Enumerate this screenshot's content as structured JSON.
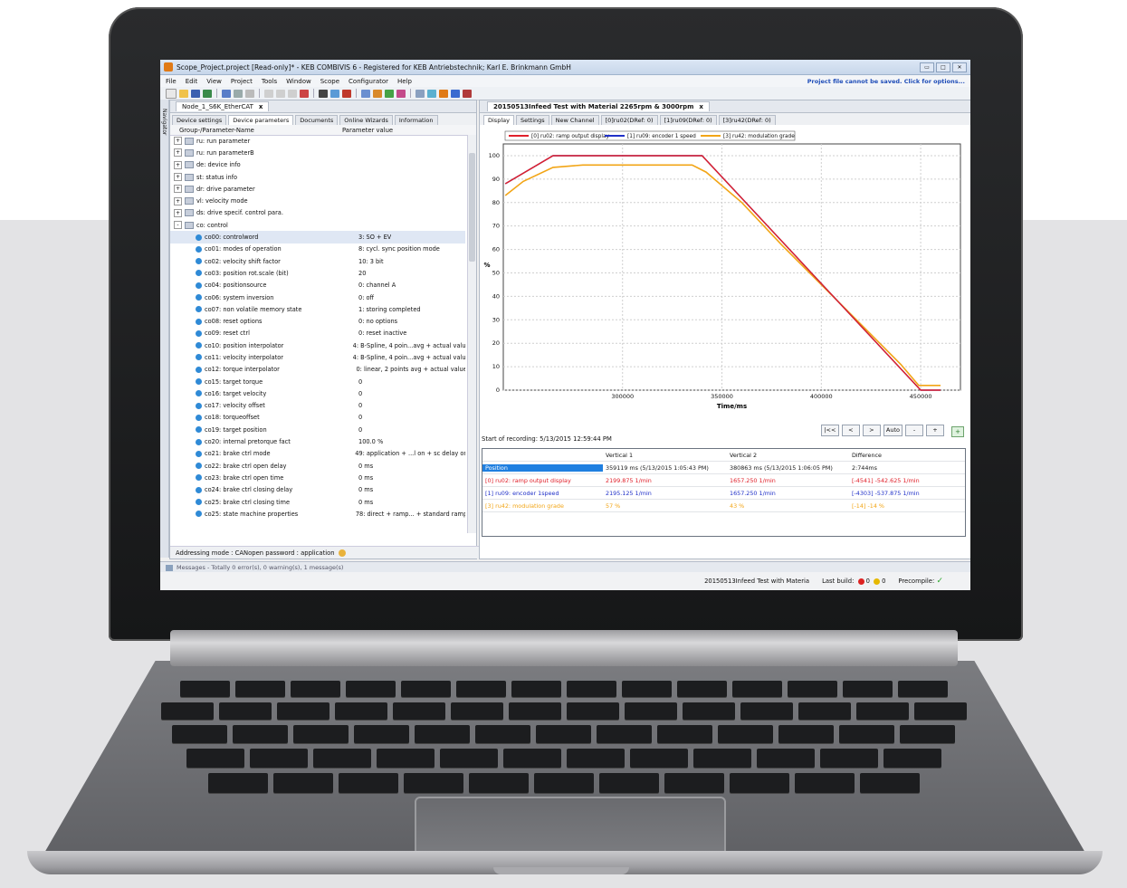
{
  "window": {
    "title": "Scope_Project.project [Read-only]* - KEB COMBIVIS 6  - Registered for KEB Antriebstechnik; Karl E. Brinkmann GmbH",
    "buttons": [
      "▭",
      "□",
      "✕"
    ]
  },
  "menu": {
    "items": [
      "File",
      "Edit",
      "View",
      "Project",
      "Tools",
      "Window",
      "Scope",
      "Configurator",
      "Help"
    ],
    "warning": "Project file cannot be saved. Click for options..."
  },
  "navigator": {
    "label": "Navigator"
  },
  "left_pane": {
    "doc_tab": "Node_1_S6K_EtherCAT",
    "close": "x",
    "sub_tabs": [
      "Device settings",
      "Device parameters",
      "Documents",
      "Online Wizards",
      "Information"
    ],
    "active_sub_tab": 1,
    "columns": [
      "Group-/Parameter-Name",
      "Parameter value"
    ],
    "rows": [
      {
        "name": "ru: run parameter",
        "value": "",
        "type": "group",
        "exp": "+"
      },
      {
        "name": "ru: run parameterB",
        "value": "",
        "type": "group",
        "exp": "+"
      },
      {
        "name": "de: device info",
        "value": "",
        "type": "group",
        "exp": "+"
      },
      {
        "name": "st: status info",
        "value": "",
        "type": "group",
        "exp": "+"
      },
      {
        "name": "dr: drive parameter",
        "value": "",
        "type": "group",
        "exp": "+"
      },
      {
        "name": "vl: velocity mode",
        "value": "",
        "type": "group",
        "exp": "+"
      },
      {
        "name": "ds: drive specif. control para.",
        "value": "",
        "type": "group",
        "exp": "+"
      },
      {
        "name": "co: control",
        "value": "",
        "type": "group",
        "exp": "-"
      },
      {
        "name": "co00: controlword",
        "value": "3: SO + EV",
        "type": "leaf",
        "selected": true
      },
      {
        "name": "co01: modes of operation",
        "value": "8: cycl. sync position mode",
        "type": "leaf"
      },
      {
        "name": "co02: velocity shift factor",
        "value": "10: 3 bit",
        "type": "leaf"
      },
      {
        "name": "co03: position rot.scale (bit)",
        "value": "20",
        "type": "leaf"
      },
      {
        "name": "co04: positionsource",
        "value": "0: channel A",
        "type": "leaf"
      },
      {
        "name": "co06: system inversion",
        "value": "0: off",
        "type": "leaf"
      },
      {
        "name": "co07: non volatile memory state",
        "value": "1: storing completed",
        "type": "leaf"
      },
      {
        "name": "co08: reset options",
        "value": "0: no options",
        "type": "leaf"
      },
      {
        "name": "co09: reset ctrl",
        "value": "0: reset inactive",
        "type": "leaf"
      },
      {
        "name": "co10: position interpolator",
        "value": "4: B-Spline, 4 poin...avg + actual value",
        "type": "leaf"
      },
      {
        "name": "co11: velocity interpolator",
        "value": "4: B-Spline, 4 poin...avg + actual value",
        "type": "leaf"
      },
      {
        "name": "co12: torque interpolator",
        "value": "0: linear, 2 points avg + actual value",
        "type": "leaf"
      },
      {
        "name": "co15: target torque",
        "value": "0",
        "type": "leaf"
      },
      {
        "name": "co16: target velocity",
        "value": "0",
        "type": "leaf"
      },
      {
        "name": "co17: velocity offset",
        "value": "0",
        "type": "leaf"
      },
      {
        "name": "co18: torqueoffset",
        "value": "0",
        "type": "leaf"
      },
      {
        "name": "co19: target position",
        "value": "0",
        "type": "leaf"
      },
      {
        "name": "co20: internal pretorque fact",
        "value": "100.0 %",
        "type": "leaf"
      },
      {
        "name": "co21: brake ctrl mode",
        "value": "49: application + ...l on + sc delay on",
        "type": "leaf"
      },
      {
        "name": "co22: brake ctrl open delay",
        "value": "0 ms",
        "type": "leaf"
      },
      {
        "name": "co23: brake ctrl open time",
        "value": "0 ms",
        "type": "leaf"
      },
      {
        "name": "co24: brake ctrl closing delay",
        "value": "0 ms",
        "type": "leaf"
      },
      {
        "name": "co25: brake ctrl closing time",
        "value": "0 ms",
        "type": "leaf"
      },
      {
        "name": "co25: state machine properties",
        "value": "78: direct + ramp... + standard ramp",
        "type": "leaf"
      }
    ],
    "addressing": "Addressing mode : CANopen   password : application"
  },
  "right_pane": {
    "doc_tab": "20150513Infeed Test with Material 2265rpm & 3000rpm",
    "close": "x",
    "sub_tabs": [
      "Display",
      "Settings",
      "New Channel",
      "[0]ru02(DRef: 0)",
      "[1]ru09(DRef: 0)",
      "[3]ru42(DRef: 0)"
    ],
    "recording_start": "Start of recording: 5/13/2015 12:59:44 PM",
    "nav_buttons": [
      "|<<",
      "<",
      ">",
      "Auto",
      "-",
      "+"
    ],
    "add_button": "+",
    "cursor_table": {
      "headers": [
        "",
        "Vertical 1",
        "Vertical 2",
        "Difference"
      ],
      "rows": [
        {
          "label": "Position",
          "v1": "359119 ms (5/13/2015 1:05:43 PM)",
          "v2": "380863 ms (5/13/2015 1:06:05 PM)",
          "diff": "2:744ms",
          "color": "#1a1a1a",
          "highlight": true
        },
        {
          "label": "[0] ru02: ramp output display",
          "v1": "2199.875 1/min",
          "v2": "1657.250 1/min",
          "diff": "[-4541] -542.625 1/min",
          "color": "#e0202a"
        },
        {
          "label": "[1] ru09: encoder 1speed",
          "v1": "2195.125 1/min",
          "v2": "1657.250 1/min",
          "diff": "[-4303] -537.875 1/min",
          "color": "#2030c8"
        },
        {
          "label": "[3] ru42: modulation grade",
          "v1": "57 %",
          "v2": "43 %",
          "diff": "[-14] -14 %",
          "color": "#f2a516"
        }
      ]
    }
  },
  "chart_data": {
    "type": "line",
    "title": "",
    "xlabel": "Time/ms",
    "ylabel": "%",
    "xlim": [
      240000,
      470000
    ],
    "ylim": [
      0,
      105
    ],
    "xticks": [
      300000,
      350000,
      400000,
      450000
    ],
    "yticks": [
      0,
      10,
      20,
      30,
      40,
      50,
      60,
      70,
      80,
      90,
      100
    ],
    "grid": true,
    "legend_position": "top",
    "series": [
      {
        "name": "[0] ru02: ramp output display",
        "color": "#e0202a",
        "x": [
          241000,
          265000,
          330000,
          340000,
          450000,
          460000
        ],
        "y": [
          88,
          100,
          100,
          100,
          0,
          0
        ]
      },
      {
        "name": "[1] ru09: encoder 1 speed",
        "color": "#2030c8",
        "x": [
          241000,
          265000,
          330000,
          340000,
          450000,
          460000
        ],
        "y": [
          88,
          100,
          100,
          100,
          0,
          0
        ]
      },
      {
        "name": "[3] ru42: modulation grade",
        "color": "#f2a516",
        "x": [
          241000,
          250000,
          265000,
          280000,
          300000,
          320000,
          335000,
          342000,
          360000,
          380000,
          400000,
          420000,
          440000,
          449000,
          452000,
          460000
        ],
        "y": [
          83,
          89,
          95,
          96,
          96,
          96,
          96,
          93,
          80,
          62,
          45,
          28,
          11,
          2,
          2,
          2
        ]
      }
    ]
  },
  "status": {
    "messages": "Messages - Totally 0 error(s), 0 warning(s), 1 message(s)",
    "project": "20150513Infeed Test with Materia",
    "last_build": "Last build:",
    "errors": "0",
    "warnings": "0",
    "precompile": "Precompile:",
    "check": "✓"
  }
}
